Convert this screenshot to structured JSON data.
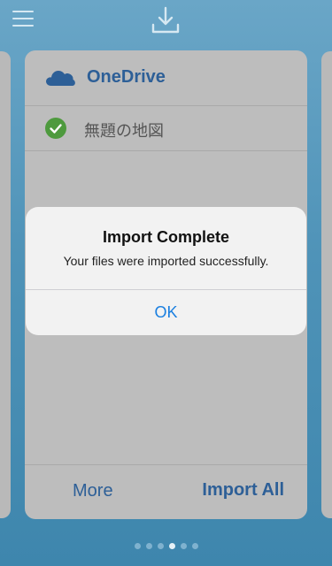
{
  "topbar": {
    "menu_icon": "hamburger-menu-icon",
    "download_icon": "download-icon"
  },
  "card": {
    "service": {
      "icon": "onedrive-cloud-icon",
      "name": "OneDrive",
      "brand_color": "#2d5f97"
    },
    "files": [
      {
        "status_icon": "check-circle-icon",
        "status_color": "#4e9a3e",
        "name": "無題の地図"
      }
    ],
    "footer": {
      "more_label": "More",
      "import_all_label": "Import All"
    }
  },
  "pager": {
    "count": 6,
    "active_index": 3
  },
  "alert": {
    "title": "Import Complete",
    "message": "Your files were imported successfully.",
    "ok_label": "OK",
    "button_color": "#1a7fe0"
  }
}
